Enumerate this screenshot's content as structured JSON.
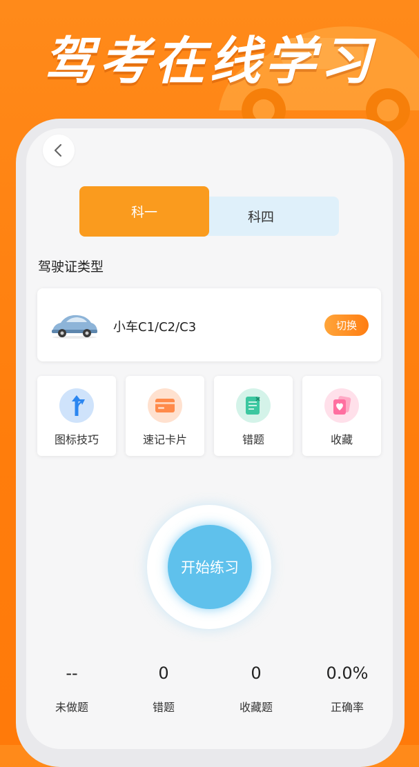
{
  "banner": {
    "headline": "驾考在线学习"
  },
  "tabs": [
    {
      "label": "科一",
      "active": true
    },
    {
      "label": "科四",
      "active": false
    }
  ],
  "license": {
    "section_title": "驾驶证类型",
    "current": "小车C1/C2/C3",
    "switch_label": "切换"
  },
  "tools": [
    {
      "label": "图标技巧",
      "icon": "road-sign-icon",
      "color": "#2b86f0"
    },
    {
      "label": "速记卡片",
      "icon": "card-icon",
      "color": "#ff8a4a"
    },
    {
      "label": "错题",
      "icon": "wrong-notebook-icon",
      "color": "#3cc7a0"
    },
    {
      "label": "收藏",
      "icon": "heart-card-icon",
      "color": "#ff6fa0"
    }
  ],
  "start_button": {
    "label": "开始练习"
  },
  "stats": [
    {
      "value": "--",
      "label": "未做题"
    },
    {
      "value": "0",
      "label": "错题"
    },
    {
      "value": "0",
      "label": "收藏题"
    },
    {
      "value": "0.0%",
      "label": "正确率"
    }
  ],
  "colors": {
    "brand_orange": "#ff7d0c",
    "active_tab": "#fa9b1e",
    "inactive_tab": "#dff0fa",
    "start_button": "#5fc1ec"
  }
}
